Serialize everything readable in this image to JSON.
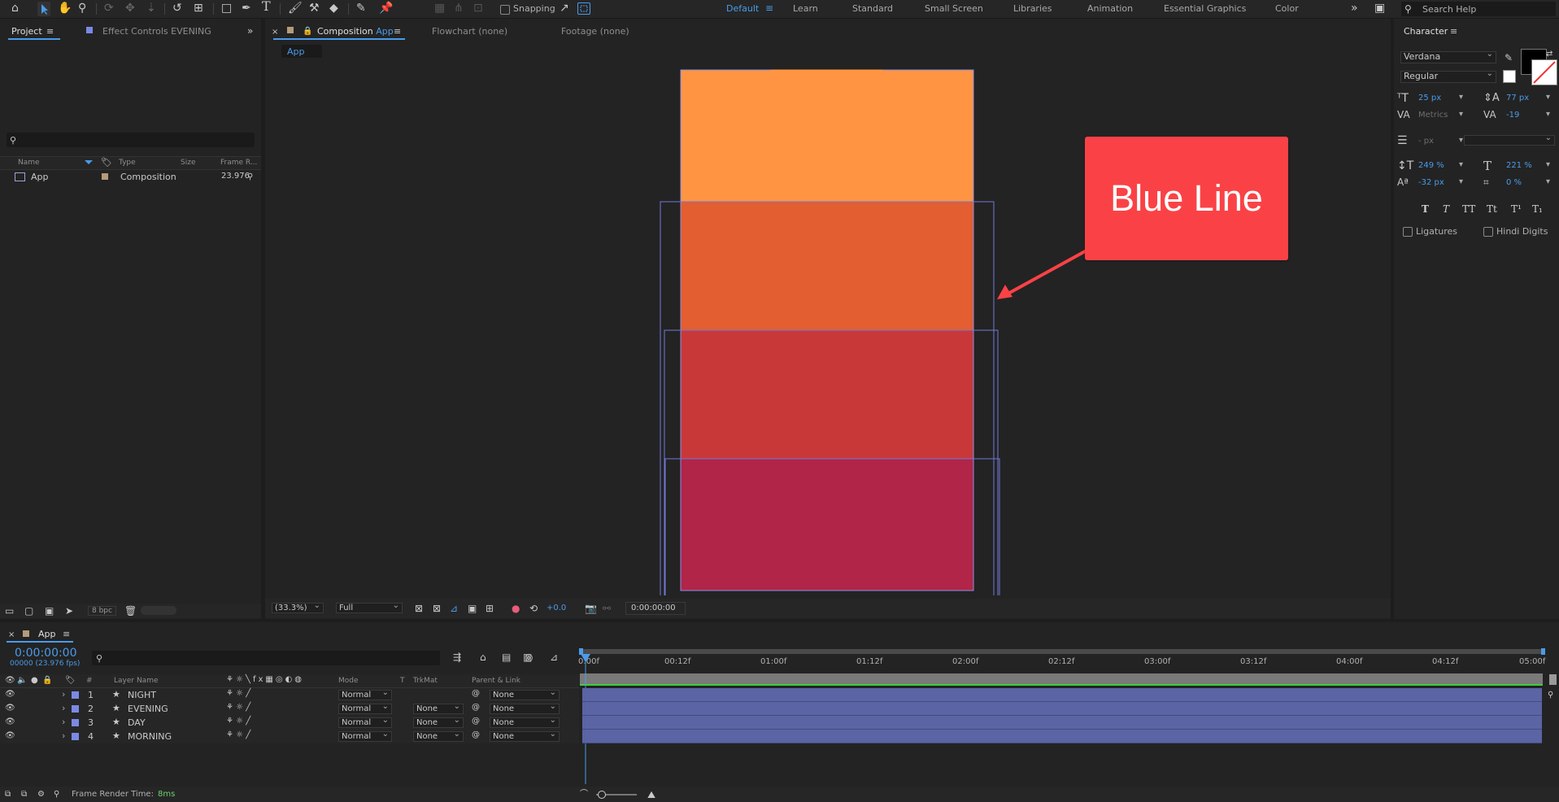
{
  "toolbar": {
    "snapping_label": "Snapping",
    "workspaces": [
      "Default",
      "Learn",
      "Standard",
      "Small Screen",
      "Libraries",
      "Animation",
      "Essential Graphics",
      "Color"
    ],
    "active_workspace": "Default",
    "search_placeholder": "Search Help"
  },
  "project_panel": {
    "tab_project": "Project",
    "tab_effect_controls": "Effect Controls EVENING",
    "columns": [
      "Name",
      "Type",
      "Size",
      "Frame R..."
    ],
    "items": [
      {
        "name": "App",
        "type": "Composition",
        "frame_rate": "23.976"
      }
    ],
    "bpc": "8 bpc"
  },
  "viewer": {
    "tab_composition_prefix": "Composition",
    "tab_composition_name": "App",
    "tab_flowchart": "Flowchart (none)",
    "tab_footage": "Footage (none)",
    "breadcrumb": "App",
    "magnification": "(33.3%)",
    "resolution": "Full",
    "exposure": "+0.0",
    "timecode": "0:00:00:00",
    "stripes": [
      {
        "name": "NIGHT",
        "color": "#ff9442"
      },
      {
        "name": "EVENING",
        "color": "#e35e30"
      },
      {
        "name": "DAY",
        "color": "#c93838"
      },
      {
        "name": "MORNING",
        "color": "#b02548"
      }
    ],
    "callout": {
      "text": "Blue Line",
      "color": "#fa4246"
    }
  },
  "character": {
    "title": "Character",
    "font_family": "Verdana",
    "font_style": "Regular",
    "font_size": "25 px",
    "leading": "77 px",
    "kerning": "Metrics",
    "tracking": "-19",
    "stroke_width": "- px",
    "vert_scale": "249 %",
    "horiz_scale": "221 %",
    "baseline_shift": "-32 px",
    "tsume": "0 %",
    "style_buttons": [
      "T",
      "T",
      "TT",
      "Tt",
      "T¹",
      "T₁"
    ],
    "ligatures_label": "Ligatures",
    "hindi_digits_label": "Hindi Digits"
  },
  "timeline": {
    "comp_tab": "App",
    "current_time": "0:00:00:00",
    "frame_info": "00000 (23.976 fps)",
    "columns": {
      "layer_name": "Layer Name",
      "mode": "Mode",
      "t": "T",
      "trkmat": "TrkMat",
      "parent": "Parent & Link"
    },
    "layers": [
      {
        "num": "1",
        "name": "NIGHT",
        "mode": "Normal",
        "trkmat": "",
        "parent": "None"
      },
      {
        "num": "2",
        "name": "EVENING",
        "mode": "Normal",
        "trkmat": "None",
        "parent": "None"
      },
      {
        "num": "3",
        "name": "DAY",
        "mode": "Normal",
        "trkmat": "None",
        "parent": "None"
      },
      {
        "num": "4",
        "name": "MORNING",
        "mode": "Normal",
        "trkmat": "None",
        "parent": "None"
      }
    ],
    "ruler_ticks": [
      "0:00f",
      "00:12f",
      "01:00f",
      "01:12f",
      "02:00f",
      "02:12f",
      "03:00f",
      "03:12f",
      "04:00f",
      "04:12f",
      "05:00f"
    ],
    "render_time_label": "Frame Render Time:",
    "render_time_value": "8ms"
  }
}
